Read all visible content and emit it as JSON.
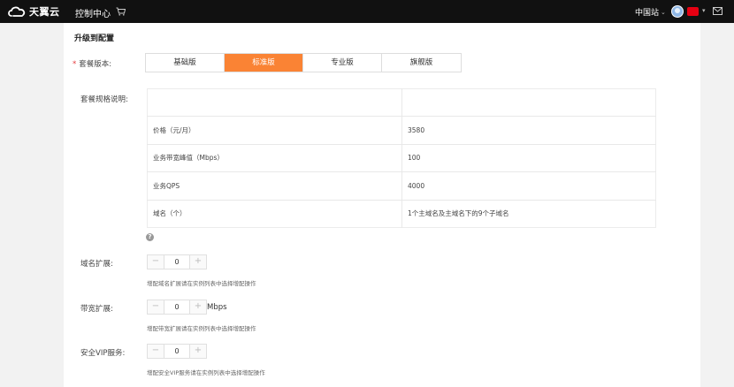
{
  "topbar": {
    "brand": "天翼云",
    "console": "控制中心",
    "region": "中国站",
    "colors": {
      "bg": "#111111",
      "badge": "#e60012"
    }
  },
  "section": {
    "title": "升级到配置"
  },
  "package": {
    "label": "套餐版本:",
    "tabs": [
      {
        "label": "基础版",
        "active": false
      },
      {
        "label": "标准版",
        "active": true
      },
      {
        "label": "专业版",
        "active": false
      },
      {
        "label": "旗舰版",
        "active": false
      }
    ],
    "accent": "#fa8334"
  },
  "spec": {
    "label": "套餐规格说明:",
    "rows": [
      {
        "name": "",
        "value": ""
      },
      {
        "name": "价格（元/月）",
        "value": "3580"
      },
      {
        "name": "业务带宽峰值（Mbps）",
        "value": "100"
      },
      {
        "name": "业务QPS",
        "value": "4000"
      },
      {
        "name": "域名（个）",
        "value": "1个主域名及主域名下的9个子域名"
      }
    ]
  },
  "domain_ext": {
    "label": "域名扩展:",
    "value": "0",
    "minus": "−",
    "plus": "+",
    "hint": "增配域名扩展请在实例列表中选择增配操作"
  },
  "bandwidth_ext": {
    "label": "带宽扩展:",
    "value": "0",
    "minus": "−",
    "plus": "+",
    "unit": "Mbps",
    "hint": "增配带宽扩展请在实例列表中选择增配操作"
  },
  "vip_service": {
    "label": "安全VIP服务:",
    "value": "0",
    "minus": "−",
    "plus": "+",
    "hint": "增配安全VIP服务请在实例列表中选择增配操作"
  }
}
